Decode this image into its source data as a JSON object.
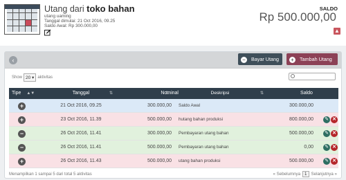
{
  "header": {
    "title_prefix": "Utang dari",
    "title_name": "toko bahan",
    "subtitle": "utang uaming",
    "start_date": "Tanggal dimulai: 21 Oct 2016, 09.25",
    "initial_balance": "Saldo Awal: Rp 300.000,00",
    "saldo_label": "SALDO",
    "saldo_value": "Rp 500.000,00"
  },
  "toolbar": {
    "bayar_label": "Bayar Utang",
    "tambah_label": "Tambah Utang"
  },
  "list_controls": {
    "show_label": "Show",
    "page_size": "20",
    "page_size_suffix": "aktivitas"
  },
  "table": {
    "columns": [
      "Tipe",
      "Tanggal",
      "Nominal",
      "Deskripsi",
      "Saldo"
    ],
    "rows": [
      {
        "type": "plus",
        "color": "blue",
        "date": "21 Oct 2016, 09.25",
        "nominal": "300.000,00",
        "desc": "Saldo Awal",
        "saldo": "300.000,00",
        "actions": false
      },
      {
        "type": "plus",
        "color": "pink",
        "date": "23 Oct 2016, 11.39",
        "nominal": "500.000,00",
        "desc": "hutang bahan produksi",
        "saldo": "800.000,00",
        "actions": true
      },
      {
        "type": "minus",
        "color": "green",
        "date": "26 Oct 2016, 11.41",
        "nominal": "300.000,00",
        "desc": "Pembayaran utang bahan",
        "saldo": "500.000,00",
        "actions": true
      },
      {
        "type": "minus",
        "color": "green",
        "date": "26 Oct 2016, 11.41",
        "nominal": "500.000,00",
        "desc": "Pembayaran utang bahan",
        "saldo": "0,00",
        "actions": true
      },
      {
        "type": "plus",
        "color": "pink",
        "date": "26 Oct 2016, 11.43",
        "nominal": "500.000,00",
        "desc": "utang bahan produksi",
        "saldo": "500.000,00",
        "actions": true
      }
    ]
  },
  "footer": {
    "summary": "Menampilkan 1 sampai 5 dari total 5 aktivitas",
    "prev_label": "« Sebelumnya",
    "current_page": "1",
    "next_label": "Selanjutnya »"
  },
  "colors": {
    "header_dark": "#2f3e4b",
    "bayar": "#3f4f5a",
    "tambah": "#8c4156",
    "row_blue": "#dbe9f7",
    "row_pink": "#f9e1e5",
    "row_green": "#e1f1dd"
  }
}
